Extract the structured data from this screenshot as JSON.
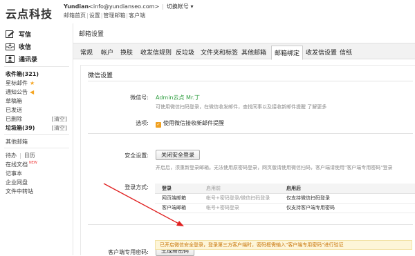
{
  "header": {
    "logo": "云点科技",
    "user_name": "Yundian",
    "user_email": "<info@yundianseo.com>",
    "switch_account": "切换帐号",
    "links": [
      "邮箱首页",
      "设置",
      "管理邮箱",
      "客户端"
    ]
  },
  "sidebar": {
    "actions": [
      {
        "label": "写信",
        "icon": "compose-icon"
      },
      {
        "label": "收信",
        "icon": "inbox-icon"
      },
      {
        "label": "通讯录",
        "icon": "contacts-icon"
      }
    ],
    "folders": [
      {
        "label": "收件箱(321)",
        "bold": true
      },
      {
        "label": "星标邮件",
        "badge": "star"
      },
      {
        "label": "通知公告",
        "badge": "megaphone"
      },
      {
        "label": "草稿箱"
      },
      {
        "label": "已发送"
      },
      {
        "label": "已删除",
        "clear": "[清空]"
      },
      {
        "label": "垃圾箱(39)",
        "bold": true,
        "clear": "[清空]"
      }
    ],
    "other_folder": "其他邮箱",
    "tools": {
      "todo": "待办",
      "calendar": "日历",
      "online_docs": "在线文档",
      "new_tag": "NEW",
      "notes": "记事本",
      "netdisk": "企业网盘",
      "transfer": "文件中转站"
    }
  },
  "main": {
    "title": "邮箱设置",
    "tabs": [
      "常规",
      "帐户",
      "换肤",
      "收发信规则",
      "反垃圾",
      "文件夹和标签",
      "其他邮箱",
      "邮箱绑定",
      "收发信设置",
      "信纸"
    ],
    "active_tab": "邮箱绑定",
    "section_title": "微信设置",
    "wechat": {
      "label": "微信号:",
      "value": "Admin云点 Mr.丁",
      "hint": "可使用微信扫码登录，在微信收发邮件，查找同事以及接收新邮件提醒 了解更多"
    },
    "options": {
      "label": "选项:",
      "checkbox_label": "使用微信接收新邮件提醒",
      "checked": true
    },
    "security": {
      "label": "安全设置:",
      "button": "关闭安全登录",
      "hint": "开启后，须重新登录邮箱。无法使用原密码登录，网页版请使用微信扫码，客户端请使用\"客户端专用密码\"登录"
    },
    "login_methods": {
      "label": "登录方式:",
      "headers": [
        "登录",
        "启用前",
        "启用后"
      ],
      "rows": [
        [
          "网页端邮箱",
          "帐号+密码登录/微信扫码登录",
          "仅支持微信扫码登录"
        ],
        [
          "客户端邮箱",
          "帐号+密码登录",
          "仅支持客户端专用密码"
        ]
      ]
    },
    "client_password": {
      "label": "客户端专用密码:",
      "button": "生成新密码",
      "notice": "已开启微信安全登录，登录第三方客户端时，密码框需输入\"客户端专用密码\"进行验证"
    }
  },
  "colors": {
    "arrow": "#e02020",
    "wechat_green": "#2e9e3f",
    "notice_text": "#c9770c",
    "notice_bg": "#fdf5d8"
  }
}
